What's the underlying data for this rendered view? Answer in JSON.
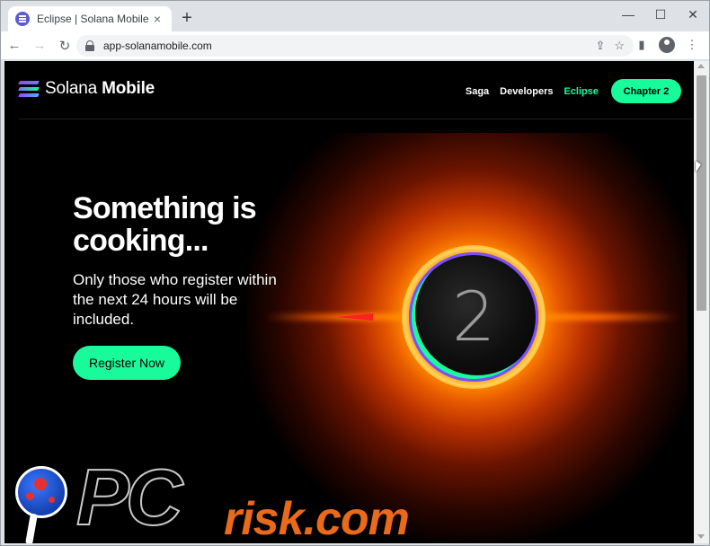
{
  "browser": {
    "tab": {
      "favicon": "solana-favicon",
      "title": "Eclipse | Solana Mobile",
      "close": "×"
    },
    "new_tab": "+",
    "window_controls": {
      "minimize": "—",
      "maximize": "☐",
      "close": "✕"
    },
    "nav": {
      "back": "←",
      "forward": "→",
      "reload": "↻"
    },
    "url": "app-solanamobile.com",
    "omnibox_icons": {
      "share": "⇪",
      "bookmark": "☆"
    },
    "toolbar_icons": {
      "sidebar": "▮",
      "menu": "⋮"
    }
  },
  "page": {
    "logo": {
      "regular": "Solana",
      "bold": "Mobile"
    },
    "nav_links": [
      {
        "label": "Saga",
        "active": false
      },
      {
        "label": "Developers",
        "active": false
      },
      {
        "label": "Eclipse",
        "active": true
      }
    ],
    "cta": "Chapter 2",
    "hero": {
      "title": "Something is cooking...",
      "subtitle": "Only those who register within the next 24 hours will be included.",
      "button": "Register Now"
    },
    "eclipse_number": "2"
  },
  "watermark": {
    "pc": "PC",
    "risk": "risk.com"
  },
  "colors": {
    "accent": "#19fb9b",
    "background": "#000000",
    "eclipse_orange": "#ff8a00",
    "watermark_orange": "#e86a1a"
  }
}
